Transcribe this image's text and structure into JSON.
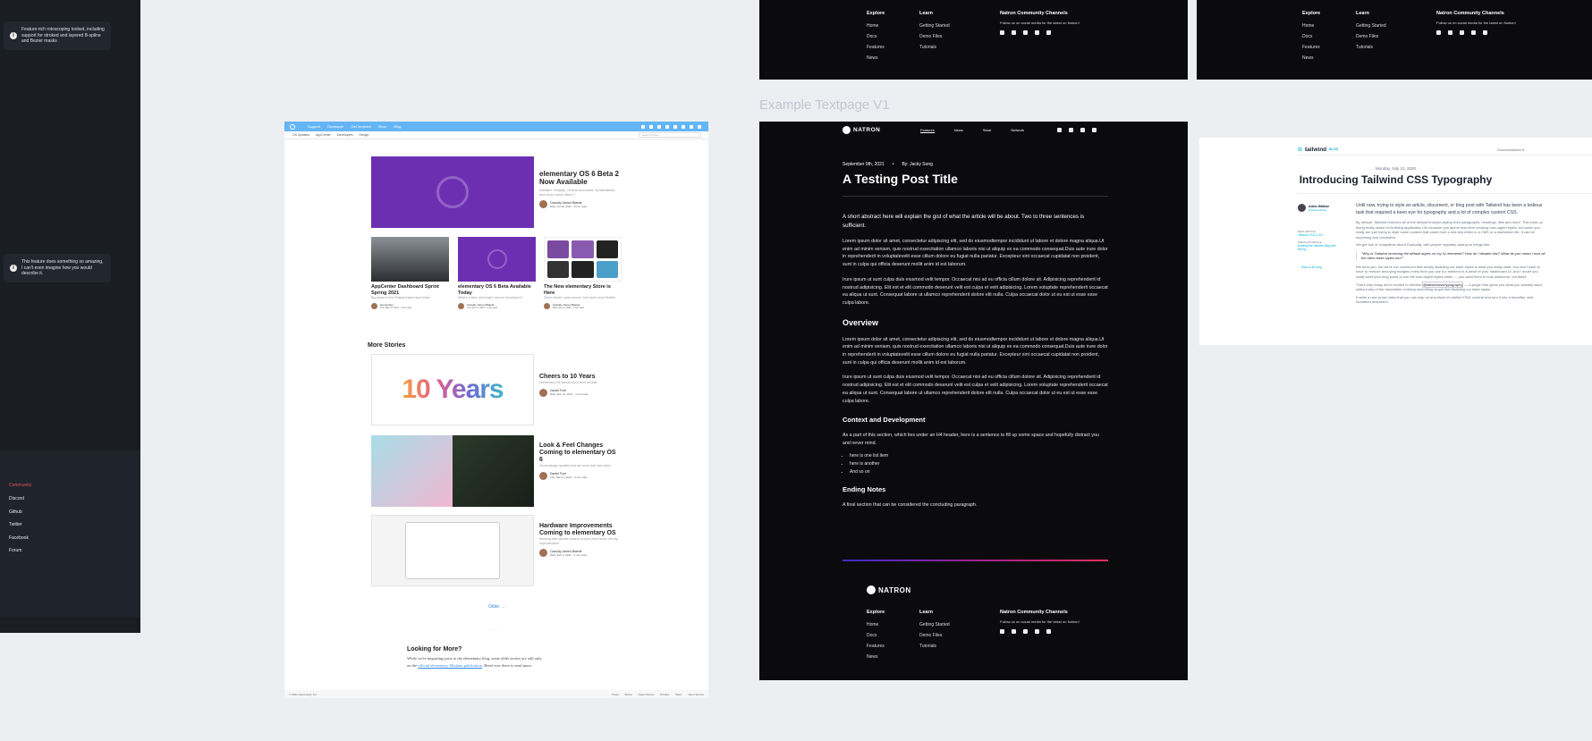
{
  "left_panel": {
    "tip1": "Feature-rich rotoscoping toolset, including support for stroked and layered B-spline and Bezier masks",
    "tip2": "This feature does something so amazing, I can't even imagine how you would describe it.",
    "community_heading": "Community",
    "community_links": [
      "Discord",
      "Github",
      "Twitter",
      "Facebook",
      "Forum"
    ],
    "colors": {
      "accent": "#e0525c",
      "bg": "#1a1d24"
    }
  },
  "blog": {
    "nav_items": [
      "Support",
      "Developer",
      "Get Involved",
      "Store",
      "Blog"
    ],
    "subnav_items": [
      "OS Updates",
      "AppCenter",
      "Developers",
      "Design"
    ],
    "search_placeholder": "Search Posts...",
    "hero": {
      "title": "elementary OS 6 Beta 2 Now Available",
      "subtitle": "Installer, Flatpak, Online Accounts, Notifications, and more since Beta 1",
      "author": "Cassidy James Blaede",
      "date": "Wed, Jul 28, 2021 · 8 min read"
    },
    "cards": [
      {
        "title": "AppCenter Dashboard Sprint Spring 2021",
        "subtitle": "Big plans for the Flatpak-based AppCenter",
        "author": "elementary",
        "date": "Thu, May 27, 2021 · 3 min read"
      },
      {
        "title": "elementary OS 6 Beta Available Today",
        "subtitle": "What's a beta, and what's new for developers?",
        "author": "Cassidy James Blaede",
        "date": "Tue, Apr 27, 2021 · 9 min read"
      },
      {
        "title": "The New elementary Store is Here",
        "subtitle": "Share stories, open source, and much more flexible",
        "author": "Cassidy James Blaede",
        "date": "Wed, Apr 21, 2021 · 3 min read"
      }
    ],
    "more_stories_heading": "More Stories",
    "stories": [
      {
        "title": "Cheers to 10 Years",
        "subtitle": "elementary OS stands out to third decade",
        "author": "Daniel Foré",
        "date": "Wed, Mar 31, 2021 · 4 min read",
        "image_text": "10 Years"
      },
      {
        "title": "Look & Feel Changes Coming to elementary OS 6",
        "subtitle": "Visual design updates that are more than skin deep",
        "author": "Daniel Foré",
        "date": "Thu, Mar 11, 2021 · 4 min read"
      },
      {
        "title": "Hardware Improvements Coming to elementary OS",
        "subtitle": "Working with various makers of every form factor, the big improvements",
        "author": "Cassidy James Blaede",
        "date": "Wed, Feb 3, 2021 · 3 min read"
      }
    ],
    "older_link": "Older →",
    "looking_heading": "Looking for More?",
    "looking_text_1": "While we're migrating posts to the elementary blog, some older stories are still only",
    "looking_text_2_pre": "on the ",
    "looking_link": "official elementary Medium publication",
    "looking_text_2_post": ". Head over there to read more.",
    "footer_copy": "© 2021 elementary, Inc.",
    "footer_links": [
      "Press",
      "Brand",
      "Open Source",
      "Privacy",
      "Store",
      "Open Source"
    ]
  },
  "top_footers": {
    "explore_heading": "Explore",
    "explore_links": [
      "Home",
      "Docs",
      "Features",
      "News"
    ],
    "learn_heading": "Learn",
    "learn_links": [
      "Getting Started",
      "Demo Files",
      "Tutorials"
    ],
    "community_heading": "Natron Community Channels",
    "community_text": "Follow us on social media for the latest on Natron!"
  },
  "section_label": "Example Textpage V1",
  "post": {
    "logo": "NATRON",
    "nav": [
      "Features",
      "News",
      "Store",
      "Network"
    ],
    "date": "September 9th, 2021",
    "author": "By: Jacky Song",
    "title": "A Testing Post Title",
    "abstract": "A short abstract here will explain the gist of what the article will be about. Two to three sentences is sufficient.",
    "lorem1": "Lorem ipsum dolor sit amet, consectetur adipiscing elit, sed do eiusmodtempor incididunt ut labore et dolore magna aliqua.Ut enim ad minim veniam, quis nostrud exercitation ullamco laboris nisi ut aliquip ex ea commodo consequat.Duis aute irure dolor in reprehenderit in voluptatevelit esse cillum dolore eu fugiat nulla pariatur. Excepteur sint occaecat cupidatat non proident, sunt in culpa qui officia deserunt mollit anim id est laborum.",
    "lorem2": "Irure ipsum ut sunt culpa duis eiusmod velit tempor. Occaecat nisi ad eu officia cillum dolore sit. Adipisicing reprehenderit id nostrud adipisicing. Elit est et elit commodo deserunt velit est culpa et velit adipisicing. Lorem voluptate reprehenderit occaecat ea aliqua ut sunt. Consequat labore ut ullamco reprehenderit dolore elit nulla. Culpa occaecat dolor ut eu est ut esse esse culpa labore.",
    "overview_heading": "Overview",
    "lorem3": "Lorem ipsum dolor sit amet, consectetur adipiscing elit, sed do eiusmodtempor incididunt ut labore et dolore magna aliqua.Ut enim ad minim veniam, quis nostrud exercitation ullamco laboris nisi ut aliquip ex ea commodo consequat.Duis aute irure dolor in reprehenderit in voluptatevelit esse cillum dolore eu fugiat nulla pariatur. Excepteur sint occaecat cupidatat non proident, sunt in culpa qui officia deserunt mollit anim id est laborum.",
    "lorem4": "Irure ipsum ut sunt culpa duis eiusmod velit tempor. Occaecat nisi ad eu officia cillum dolore sit. Adipisicing reprehenderit id nostrud adipisicing. Elit est et elit commodo deserunt velit est culpa et velit adipisicing. Lorem voluptate reprehenderit occaecat ea aliqua ut sunt. Consequat labore ut ullamco reprehenderit dolore elit nulla. Culpa occaecat dolor ut eu est ut esse esse culpa labore.",
    "context_heading": "Context and Development",
    "context_text": "As a part of this section, which lies under an H4 header, here is a sentence to fill up some space and hopefully distract you and never mind.",
    "list": [
      "here is one list item",
      "here is another",
      "And so on"
    ],
    "ending_heading": "Ending Notes",
    "ending_text": "A final section that can be considered the concluding paragraph.",
    "footer_logo": "NATRON"
  },
  "tailwind": {
    "logo": "tailwind",
    "logo_suffix": "BLOG",
    "docs_link": "Documentation ▾",
    "date": "Monday, July 13, 2020",
    "title": "Introducing Tailwind CSS Typography",
    "author_name": "Adam Wathan",
    "author_handle": "@adamwathan",
    "next_label": "NEXT ARTICLE",
    "next_link": "Tailwind CSS v1.5.0",
    "prev_label": "PREVIOUS ARTICLE",
    "prev_link": "Building the Tailwind Blog with Next.js",
    "back_link": "← Back to the blog",
    "intro": "Until now, trying to style an article, document, or blog post with Tailwind has been a tedious task that required a keen eye for typography and a lot of complex custom CSS.",
    "para1": "By default, Tailwind removes all of the default browser styling from paragraphs, headings, lists and more. This ends up being really useful for building application UIs because you spend less time undoing user-agent styles, but when you really are just trying to style some content that came from a rich-text editor in a CMS or a markdown file, it can be surprising and unintuitive.",
    "para2": "We get lots of complaints about it actually, with people regularly asking us things like:",
    "quote": "\"Why is Tailwind removing the default styles on my h1 elements? How do I disable this? What do you mean I lose all the other base styles too?\"",
    "para3": "We hear you, but we're not convinced that simply disabling our base styles is what you really want. You don't want to have to remove annoying margins every time you use a p element in a piece of your dashboard UI. And I doubt you really want your blog posts to use the user-agent styles either — you want them to look awesome, not awful.",
    "para4_pre": "That's why today we're excited to release ",
    "para4_code": "@tailwindcss/typography",
    "para4_post": " — a plugin that gives you what you actually want, without any of the downsides of doing something stupid like disabling our base styles.",
    "para5": "It adds a new prose class that you can slap on any block of vanilla HTML content and turn it into a beautiful, well-formatted document.",
    "accent": "#06b6d4"
  }
}
